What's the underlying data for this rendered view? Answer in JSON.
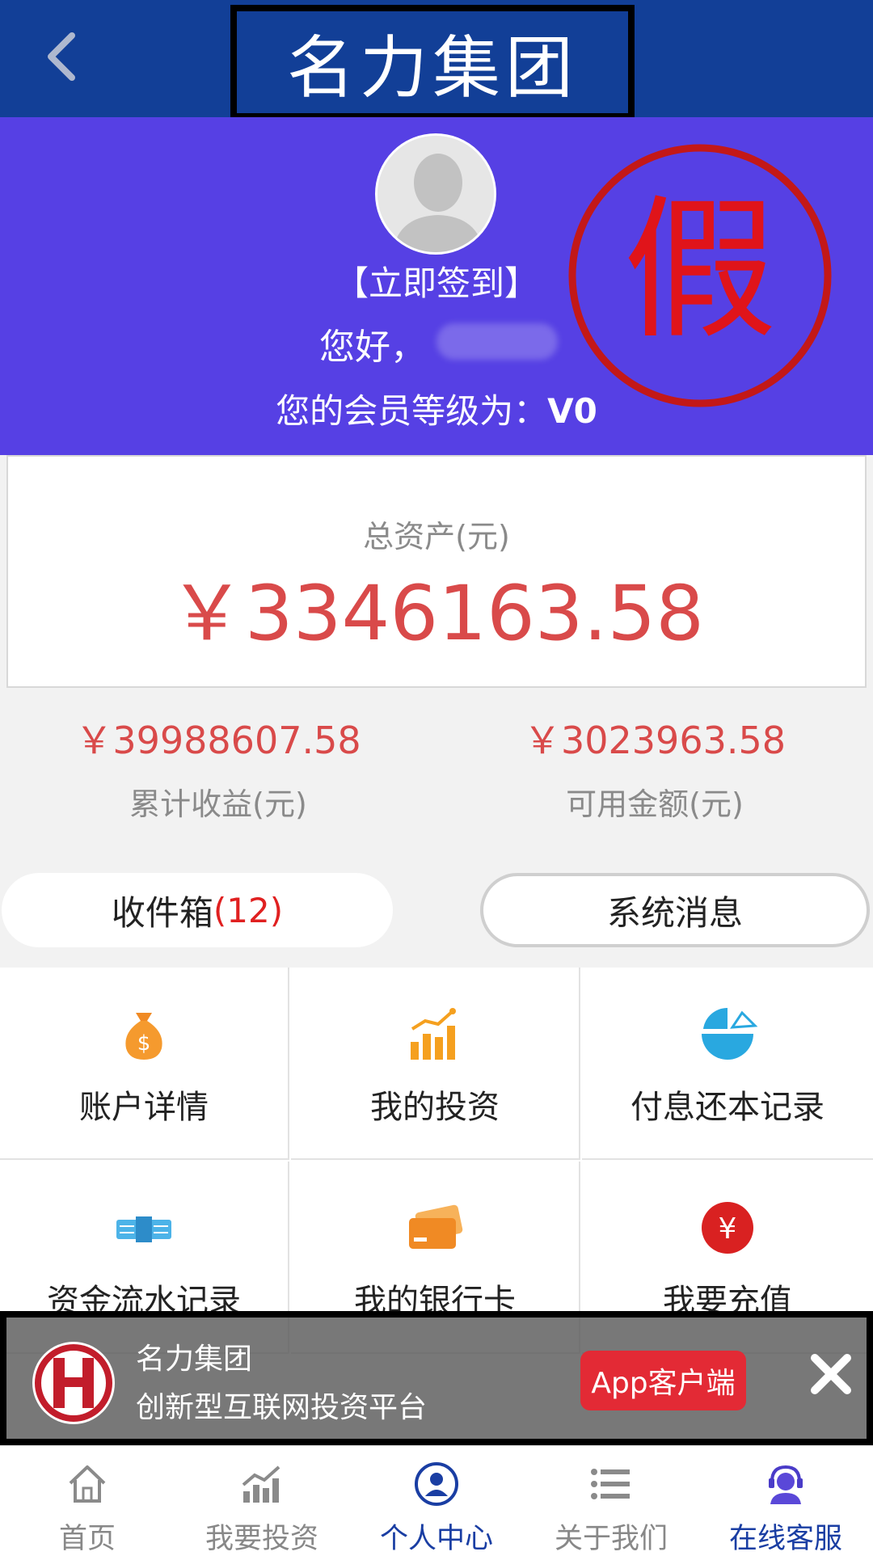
{
  "header": {
    "title": "名力集团"
  },
  "profile": {
    "signin_label": "【立即签到】",
    "greeting": "您好，",
    "level_prefix": "您的会员等级为：",
    "level": "V0",
    "stamp_text": "假",
    "bg_color": "#5640e4"
  },
  "assets": {
    "total_label": "总资产(元)",
    "total_value": "￥3346163.58",
    "cumulative_value": "￥39988607.58",
    "cumulative_label": "累计收益(元)",
    "available_value": "￥3023963.58",
    "available_label": "可用金额(元)"
  },
  "messages": {
    "inbox_label": "收件箱",
    "inbox_count": "(12)",
    "system_label": "系统消息"
  },
  "grid": {
    "items": [
      {
        "label": "账户详情",
        "icon": "money-bag-icon"
      },
      {
        "label": "我的投资",
        "icon": "bar-chart-icon"
      },
      {
        "label": "付息还本记录",
        "icon": "pie-chart-icon"
      },
      {
        "label": "资金流水记录",
        "icon": "cash-stack-icon"
      },
      {
        "label": "我的银行卡",
        "icon": "bank-card-icon"
      },
      {
        "label": "我要充值",
        "icon": "yuan-coin-icon"
      }
    ]
  },
  "banner": {
    "name": "名力集团",
    "slogan": "创新型互联网投资平台",
    "app_button": "App客户端"
  },
  "nav": {
    "tabs": [
      {
        "label": "首页",
        "icon": "home-icon"
      },
      {
        "label": "我要投资",
        "icon": "invest-chart-icon"
      },
      {
        "label": "个人中心",
        "icon": "user-circle-icon",
        "active": true
      },
      {
        "label": "关于我们",
        "icon": "list-icon"
      },
      {
        "label": "在线客服",
        "icon": "support-agent-icon"
      }
    ]
  }
}
